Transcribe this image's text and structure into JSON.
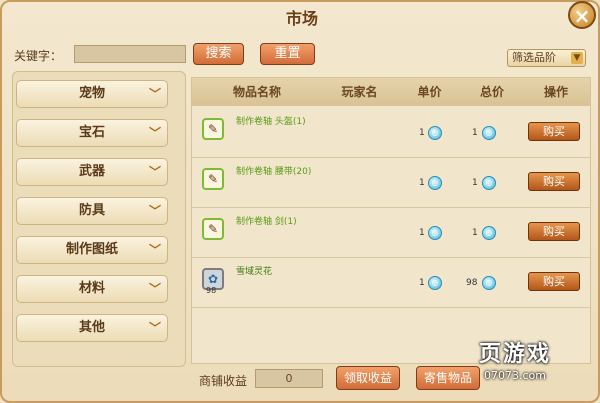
{
  "window": {
    "title": "市场",
    "close_icon": "close-icon"
  },
  "search": {
    "label": "关键字：",
    "value": "",
    "search_label": "搜索",
    "reset_label": "重置"
  },
  "filter": {
    "label": "筛选品阶",
    "icon": "chevron-down-icon"
  },
  "categories": [
    {
      "label": "宠物"
    },
    {
      "label": "宝石"
    },
    {
      "label": "武器"
    },
    {
      "label": "防具"
    },
    {
      "label": "制作图纸"
    },
    {
      "label": "材料"
    },
    {
      "label": "其他"
    }
  ],
  "table": {
    "headers": [
      "物品名称",
      "玩家名",
      "单价",
      "总价",
      "操作"
    ],
    "rows": [
      {
        "name": "制作卷轴 头盔(1)",
        "player": "",
        "unit_price": "1",
        "total_price": "1",
        "action": "购买",
        "icon": "scroll-icon",
        "qty": ""
      },
      {
        "name": "制作卷轴 腰带(20)",
        "player": "",
        "unit_price": "1",
        "total_price": "1",
        "action": "购买",
        "icon": "scroll-icon",
        "qty": ""
      },
      {
        "name": "制作卷轴 剑(1)",
        "player": "",
        "unit_price": "1",
        "total_price": "1",
        "action": "购买",
        "icon": "scroll-icon",
        "qty": ""
      },
      {
        "name": "雪域灵花",
        "player": "",
        "unit_price": "1",
        "total_price": "98",
        "action": "购买",
        "icon": "flower-icon",
        "qty": "98"
      }
    ]
  },
  "footer": {
    "income_label": "商铺收益",
    "income_value": "0",
    "collect_label": "领取收益",
    "sell_label": "寄售物品"
  },
  "watermark": {
    "text": "页游戏",
    "site": "07073.com"
  },
  "colors": {
    "accent": "#d26c38",
    "item_name": "#5a9b12",
    "panel": "#f1e6cc"
  }
}
